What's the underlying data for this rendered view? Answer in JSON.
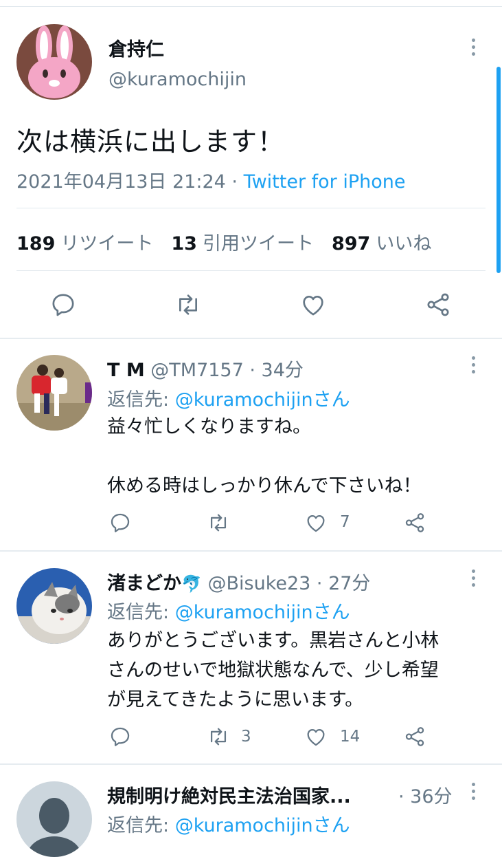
{
  "main_tweet": {
    "name": "倉持仁",
    "handle": "@kuramochijin",
    "text": "次は横浜に出します！",
    "timestamp": "2021年04月13日 21:24 · ",
    "source": "Twitter for iPhone",
    "retweets_count": "189",
    "retweets_label": "リツイート",
    "quotes_count": "13",
    "quotes_label": "引用ツイート",
    "likes_count": "897",
    "likes_label": "いいね"
  },
  "replies": [
    {
      "name": "T M",
      "handle": "@TM7157 · 34分",
      "reply_to_prefix": "返信先: ",
      "reply_to_link": "@kuramochijinさん",
      "text_line1": "益々忙しくなりますね。",
      "text_line2": "休める時はしっかり休んで下さいね！",
      "retweets": "",
      "likes": "7"
    },
    {
      "name": "渚まどか",
      "handle": "@Bisuke23 · 27分",
      "reply_to_prefix": "返信先: ",
      "reply_to_link": "@kuramochijinさん",
      "text_line1": "ありがとうございます。黒岩さんと小林",
      "text_line2": "さんのせいで地獄状態なんで、少し希望",
      "text_line3": "が見えてきたように思います。",
      "retweets": "3",
      "likes": "14"
    },
    {
      "name": "規制明け絶対民主法治国家...",
      "handle": "· 36分",
      "reply_to_prefix": "返信先: ",
      "reply_to_link": "@kuramochijinさん"
    }
  ],
  "emoji": "🐬",
  "colors": {
    "accent": "#1da1f2",
    "muted": "#657786",
    "divider": "#e1e8ed"
  },
  "icons": [
    "reply-icon",
    "retweet-icon",
    "like-icon",
    "share-icon",
    "more-icon",
    "dolphin-emoji"
  ]
}
